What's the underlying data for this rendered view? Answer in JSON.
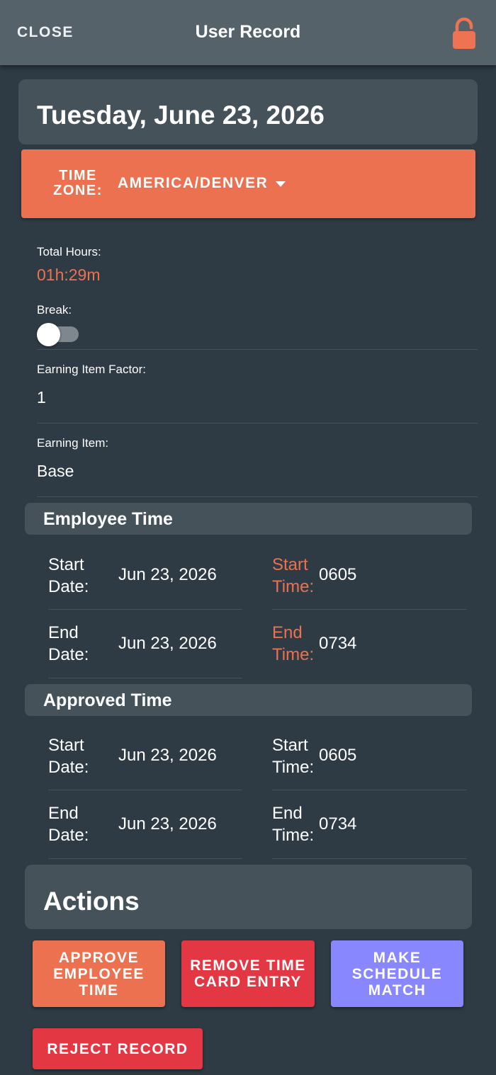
{
  "header": {
    "close_label": "CLOSE",
    "title": "User Record",
    "lock_icon": "unlock-icon",
    "lock_color": "#ee7352"
  },
  "date": "Tuesday, June 23, 2026",
  "timezone": {
    "label": "TIME ZONE:",
    "value": "AMERICA/DENVER",
    "caret_icon": "caret-down-icon"
  },
  "summary": {
    "total_hours_label": "Total Hours:",
    "total_hours_value": "01h:29m",
    "break_label": "Break:",
    "break_on": false,
    "earning_factor_label": "Earning Item Factor:",
    "earning_factor_value": "1",
    "earning_item_label": "Earning Item:",
    "earning_item_value": "Base"
  },
  "employee_time": {
    "title": "Employee Time",
    "start_date_label": "Start Date:",
    "start_date": "Jun 23, 2026",
    "start_time_label": "Start Time:",
    "start_time": "0605",
    "end_date_label": "End Date:",
    "end_date": "Jun 23, 2026",
    "end_time_label": "End Time:",
    "end_time": "0734"
  },
  "approved_time": {
    "title": "Approved Time",
    "start_date_label": "Start Date:",
    "start_date": "Jun 23, 2026",
    "start_time_label": "Start Time:",
    "start_time": "0605",
    "end_date_label": "End Date:",
    "end_date": "Jun 23, 2026",
    "end_time_label": "End Time:",
    "end_time": "0734"
  },
  "actions": {
    "title": "Actions",
    "approve_label": "APPROVE EMPLOYEE TIME",
    "remove_label": "REMOVE TIME CARD ENTRY",
    "match_label": "MAKE SCHEDULE MATCH",
    "reject_label": "REJECT RECORD"
  },
  "colors": {
    "accent": "#eb7150",
    "danger": "#e33743",
    "schedule": "#8987fd",
    "background": "#2f3b44",
    "card": "#45525a"
  }
}
